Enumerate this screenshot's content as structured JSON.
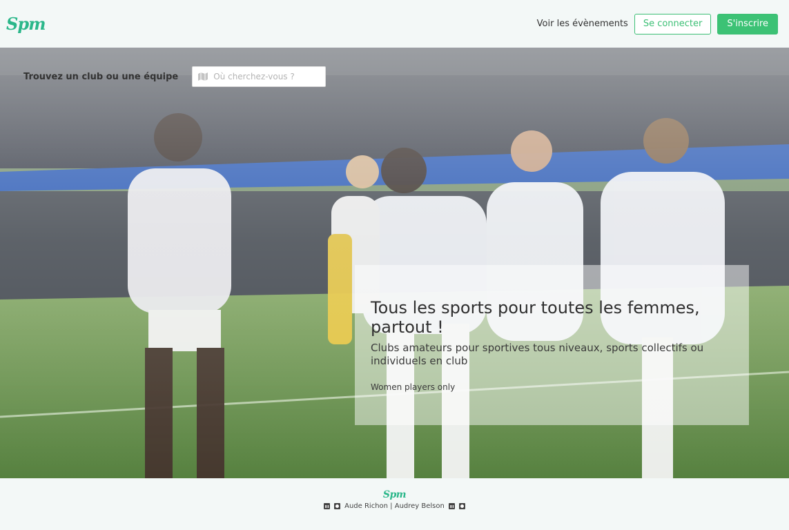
{
  "header": {
    "logo": "Spm",
    "events_link": "Voir les évènements",
    "login_button": "Se connecter",
    "signup_button": "S'inscrire"
  },
  "search": {
    "label": "Trouvez un club ou une équipe",
    "placeholder": "Où cherchez-vous ?",
    "icon": "map-icon"
  },
  "promo": {
    "title": "Tous les sports pour toutes les femmes, partout !",
    "subtitle": "Clubs amateurs pour sportives tous niveaux, sports collectifs ou individuels en club",
    "note": "Women players only"
  },
  "footer": {
    "logo": "Spm",
    "credits": "Aude Richon | Audrey Belson",
    "icons": [
      "linkedin-icon",
      "github-icon",
      "linkedin-icon",
      "github-icon"
    ]
  },
  "colors": {
    "brand": "#2bb78a",
    "button_green": "#3cc275",
    "background": "#f3f8f7"
  }
}
